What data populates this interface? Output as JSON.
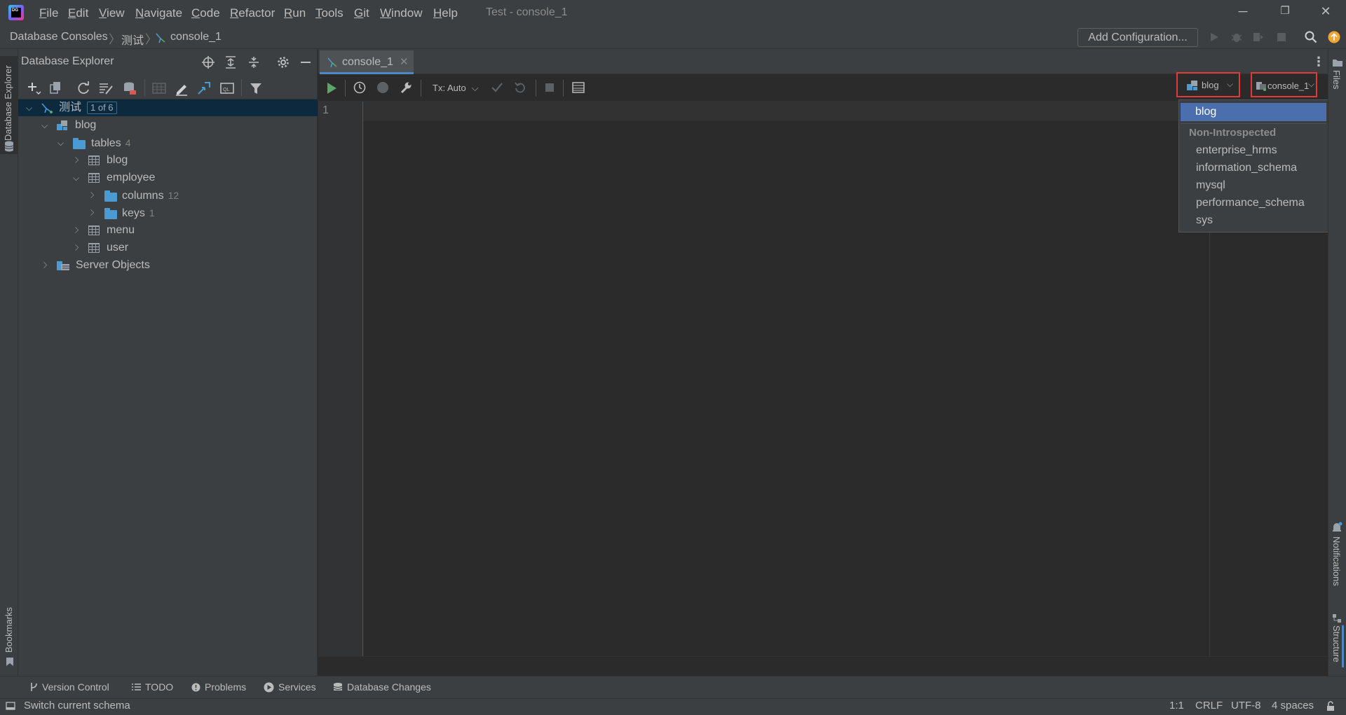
{
  "titlebar": {
    "menu": [
      "File",
      "Edit",
      "View",
      "Navigate",
      "Code",
      "Refactor",
      "Run",
      "Tools",
      "Git",
      "Window",
      "Help"
    ],
    "menu_mnemonic": [
      "F",
      "E",
      "V",
      "N",
      "C",
      "R",
      "R",
      "T",
      "G",
      "W",
      "H"
    ],
    "window_title": "Test - console_1",
    "minimize": "─",
    "restore": "❐",
    "close": "✕"
  },
  "breadcrumb": {
    "items": [
      "Database Consoles",
      "测试",
      "console_1"
    ]
  },
  "navbar": {
    "add_configuration": "Add Configuration..."
  },
  "left_strip": {
    "database_explorer": "Database Explorer",
    "bookmarks": "Bookmarks"
  },
  "panel": {
    "title": "Database Explorer",
    "tree": {
      "root_label": "测试",
      "root_badge": "1 of 6",
      "schema": "blog",
      "tables_label": "tables",
      "tables_count": "4",
      "table_blog": "blog",
      "table_employee": "employee",
      "columns_label": "columns",
      "columns_count": "12",
      "keys_label": "keys",
      "keys_count": "1",
      "table_menu": "menu",
      "table_user": "user",
      "server_objects": "Server Objects"
    }
  },
  "editor": {
    "tab_label": "console_1",
    "tx_mode": "Tx: Auto",
    "line_number": "1",
    "schema_button": "blog",
    "session_button": "console_1"
  },
  "schema_dropdown": {
    "selected": "blog",
    "group_header": "Non-Introspected",
    "items": [
      "enterprise_hrms",
      "information_schema",
      "mysql",
      "performance_schema",
      "sys"
    ]
  },
  "right_strip": {
    "files": "Files",
    "notifications": "Notifications",
    "structure": "Structure"
  },
  "bottom_tools": {
    "version_control": "Version Control",
    "todo": "TODO",
    "problems": "Problems",
    "services": "Services",
    "database_changes": "Database Changes"
  },
  "status": {
    "message": "Switch current schema",
    "position": "1:1",
    "line_ending": "CRLF",
    "encoding": "UTF-8",
    "indent": "4 spaces"
  },
  "colors": {
    "accent": "#4b6eaf",
    "highlight_box": "#e03a3a",
    "run_green": "#59a869",
    "update_orange": "#f0a732"
  }
}
